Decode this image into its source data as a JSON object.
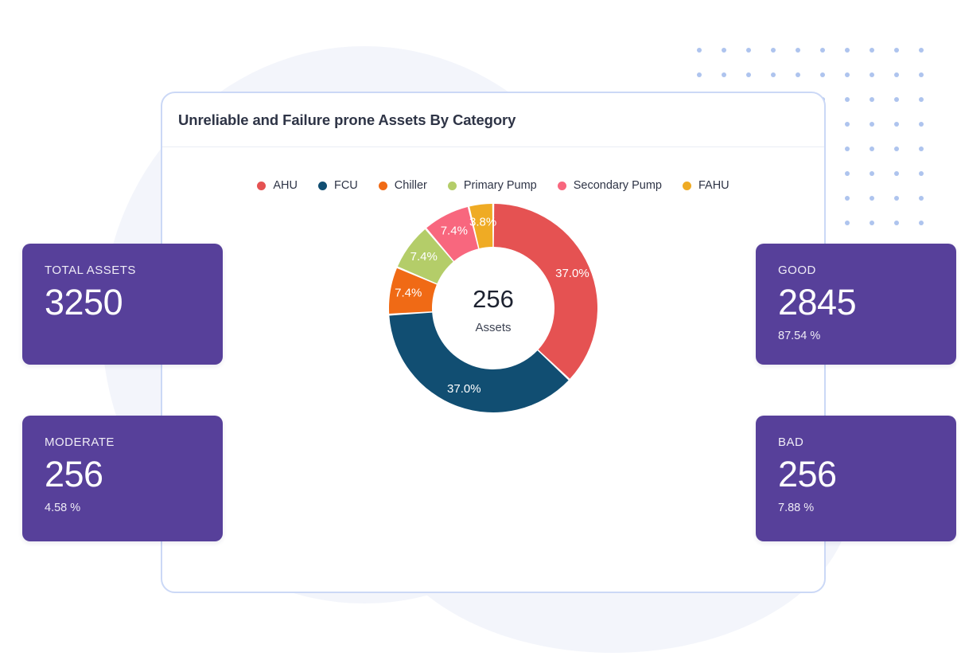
{
  "card": {
    "title": "Unreliable and Failure prone Assets By Category"
  },
  "legend": [
    {
      "label": "AHU",
      "color": "#e55252"
    },
    {
      "label": "FCU",
      "color": "#114e72"
    },
    {
      "label": "Chiller",
      "color": "#f06a15"
    },
    {
      "label": "Primary Pump",
      "color": "#b4cd69"
    },
    {
      "label": "Secondary Pump",
      "color": "#f8677e"
    },
    {
      "label": "FAHU",
      "color": "#efab24"
    }
  ],
  "donut": {
    "center_value": "256",
    "center_label": "Assets"
  },
  "stats": [
    {
      "id": "total",
      "title": "TOTAL ASSETS",
      "value": "3250",
      "pct": ""
    },
    {
      "id": "good",
      "title": "GOOD",
      "value": "2845",
      "pct": "87.54 %"
    },
    {
      "id": "moderate",
      "title": "MODERATE",
      "value": "256",
      "pct": "4.58 %"
    },
    {
      "id": "bad",
      "title": "BAD",
      "value": "256",
      "pct": "7.88 %"
    }
  ],
  "theme": {
    "purple": "#57409a",
    "card_border": "#cbd8f6",
    "dot_color": "#aec4ee",
    "blob": "#f3f5fb"
  },
  "chart_data": {
    "type": "pie",
    "variant": "donut",
    "title": "Unreliable and Failure prone Assets By Category",
    "categories": [
      "AHU",
      "FCU",
      "Chiller",
      "Primary Pump",
      "Secondary Pump",
      "FAHU"
    ],
    "values": [
      37.0,
      37.0,
      7.4,
      7.4,
      7.4,
      3.8
    ],
    "value_labels": [
      "37.0%",
      "37.0%",
      "7.4%",
      "7.4%",
      "7.4%",
      "3.8%"
    ],
    "colors": [
      "#e55252",
      "#114e72",
      "#f06a15",
      "#b4cd69",
      "#f8677e",
      "#efab24"
    ],
    "unit": "percent",
    "start_angle_deg": 0,
    "direction": "clockwise",
    "center_value": "256",
    "center_label": "Assets",
    "legend_position": "top",
    "grid": false
  }
}
